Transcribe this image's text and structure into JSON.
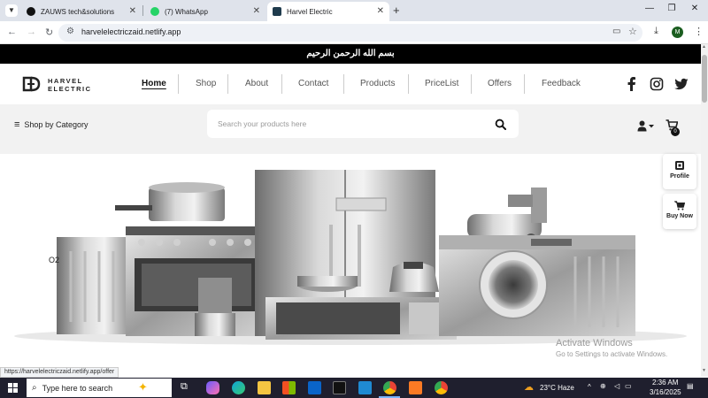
{
  "browser": {
    "tabs": [
      {
        "title": "ZAUWS tech&solutions",
        "active": false
      },
      {
        "title": "(7) WhatsApp",
        "active": false
      },
      {
        "title": "Harvel Electric",
        "active": true
      }
    ],
    "url": "harvelelectriczaid.netlify.app",
    "profile_initial": "M",
    "status_url": "https://harvelelectriczaid.netlify.app/offer"
  },
  "site": {
    "banner": "بسم الله الرحمن الرحيم",
    "logo": {
      "line1": "HARVEL",
      "line2": "ELECTRIC"
    },
    "menu": [
      {
        "label": "Home",
        "active": true
      },
      {
        "label": "Shop",
        "active": false
      },
      {
        "label": "About",
        "active": false
      },
      {
        "label": "Contact",
        "active": false
      },
      {
        "label": "Products",
        "active": false
      },
      {
        "label": "PriceList",
        "active": false
      },
      {
        "label": "Offers",
        "active": false
      },
      {
        "label": "Feedback",
        "active": false
      }
    ],
    "social_icons": [
      "facebook-icon",
      "instagram-icon",
      "twitter-icon"
    ],
    "shop_by_category": "Shop by Category",
    "search_placeholder": "Search your products here",
    "cart_count": "0",
    "side": {
      "profile": "Profile",
      "buy_now": "Buy Now"
    },
    "hero_label": "O2"
  },
  "os": {
    "activate_title": "Activate Windows",
    "activate_sub": "Go to Settings to activate Windows.",
    "taskbar_search": "Type here to search",
    "weather": "23°C  Haze",
    "time": "2:36 AM",
    "date": "3/16/2025"
  }
}
